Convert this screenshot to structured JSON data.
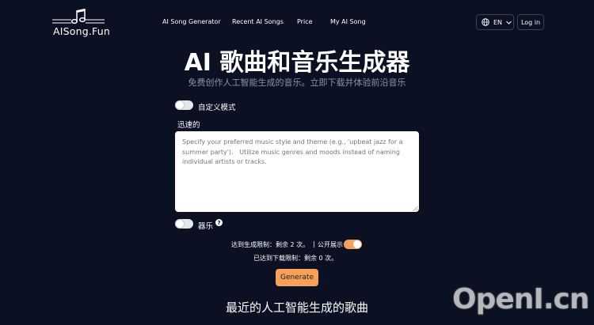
{
  "header": {
    "logo_text": "AISong.Fun",
    "nav": [
      {
        "label": "AI Song Generator"
      },
      {
        "label": "Recent AI Songs"
      },
      {
        "label": "Price"
      },
      {
        "label": "My AI Song"
      }
    ],
    "language": "EN",
    "login_label": "Log in"
  },
  "hero": {
    "title": "AI 歌曲和音乐生成器",
    "subtitle": "免费创作人工智能生成的音乐。立即下载并体验前沿音乐"
  },
  "form": {
    "custom_mode_label": "自定义模式",
    "custom_mode_on": false,
    "quick_label": "迅速的",
    "prompt_placeholder": "Specify your preferred music style and theme (e.g., 'upbeat jazz for a summer party').   Utilize music genres and moods instead of naming individual artists or tracks.",
    "prompt_value": "",
    "instrumental_label": "器乐",
    "instrumental_on": false,
    "help_glyph": "?",
    "generation_limit_text": "达到生成限制：剩余 2 次。",
    "separator": "|",
    "public_label": "公开展示",
    "public_on": true,
    "download_limit_text": "已达到下载限制：剩余 0 次。",
    "generate_label": "Generate"
  },
  "recent": {
    "title": "最近的人工智能生成的歌曲"
  },
  "watermark": "OpenI.cn",
  "colors": {
    "background": "#0b1022",
    "accent": "#f6a15a",
    "muted_text": "#8a93a8"
  },
  "icons": {
    "logo": "music-note-icon",
    "language": "globe-icon",
    "dropdown": "chevron-down-icon",
    "help": "question-circle-icon"
  }
}
